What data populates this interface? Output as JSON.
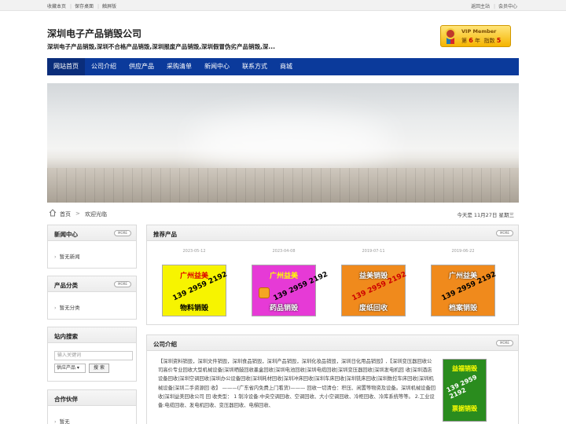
{
  "topbar": {
    "left": [
      "收藏本页",
      "保存桌面",
      "触屏版"
    ],
    "right": [
      "返回主站",
      "会员中心"
    ]
  },
  "header": {
    "title": "深圳电子产品销毁公司",
    "subtitle": "深圳电子产品销毁,深圳不合格产品销毁,深圳报废产品销毁,深圳假冒伪劣产品销毁,深..."
  },
  "vip": {
    "label": "VIP Member",
    "year_prefix": "第",
    "year": "6",
    "year_suffix": "年",
    "index_label": "指数",
    "index": "5"
  },
  "nav": {
    "items": [
      "网站首页",
      "公司介绍",
      "供应产品",
      "采购清单",
      "新闻中心",
      "联系方式",
      "商城"
    ]
  },
  "breadcrumb": {
    "home": "首页",
    "arrow": ">",
    "current": "欢迎光临",
    "date": "今天是 11月27日 星期三"
  },
  "sidebar": {
    "news": {
      "title": "新闻中心",
      "more": "MORE",
      "items": [
        "暂无新闻"
      ]
    },
    "category": {
      "title": "产品分类",
      "more": "MORE",
      "items": [
        "暂无分类"
      ]
    },
    "search": {
      "title": "站内搜索",
      "placeholder": "输入关键词",
      "select": "供应产品",
      "button": "搜 索"
    },
    "partners": {
      "title": "合作伙伴",
      "items": [
        "暂无"
      ]
    }
  },
  "products": {
    "title": "推荐产品",
    "more": "MORE",
    "items": [
      {
        "date": "2023-05-12",
        "cap1": "广州益美",
        "num": "139 2959 2192",
        "cap2": "物料销毁",
        "bg": "#f7f400",
        "cap2color": "#000"
      },
      {
        "date": "2023-04-08",
        "cap1": "广州益美",
        "num": "139 2959 2192",
        "cap2": "药品销毁",
        "bg": "#e63ad6",
        "cap2color": "#fff"
      },
      {
        "date": "2019-07-11",
        "cap1": "益美销毁",
        "num": "139 2959 2192",
        "cap2": "废纸回收",
        "bg": "#f08a1c",
        "cap2color": "#fff"
      },
      {
        "date": "2019-06-22",
        "cap1": "广州益美",
        "num": "139 2959 2192",
        "cap2": "档案销毁",
        "bg": "#f08a1c",
        "cap2color": "#fff"
      }
    ]
  },
  "about": {
    "title": "公司介绍",
    "more": "MORE",
    "text": "【深圳资料销毁，深圳文件销毁，深圳食品销毁，深圳产品销毁，深圳化妆品销毁，深圳日化用品销毁】,【深圳变压器回收公司高价专业回收大型机械设备|深圳晒鼓回收墨盒回收|深圳电池回收|深圳电缆回收|深圳变压器回收|深圳发电机回 收|深圳酒店设备回收|深圳空调回收|深圳办公设备回收|深圳耗材回收|深圳冲床回收|深圳车床回收|深圳铣床回收|深圳数控车床回收|深圳机械设备|深圳二手资源回 收】 ———(广东省内免费上门看货)——— 回收一切清仓：积压、闲置等物资及设备。深圳机械设备回收|深圳益美回收公司 回 收类型： 1 制冷设备:中央空调回收、空调回收、大小空调回收、冷柜回收、冷库系统等等。 2.工业设备:电缆回收、发电机回收、变压器回收、电梯回收、",
    "image": {
      "line1": "益福销毁",
      "line2": "139 2959 2192",
      "line3": "票据销毁"
    }
  }
}
